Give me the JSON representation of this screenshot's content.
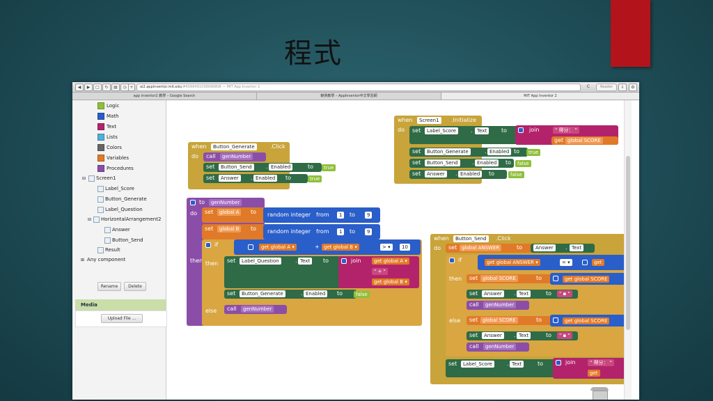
{
  "slide": {
    "title": "程式"
  },
  "browser": {
    "url": "ai2.appinventor.mit.edu",
    "url_rest": "/#6566491038996808 — MIT App Inventor 2",
    "reader": "Reader",
    "tabs": [
      "app inventor2 教學 – Google Search",
      "範例教學 – AppInventor中文學習網",
      "MIT App Inventor 2"
    ]
  },
  "sidebar": {
    "builtin": [
      "Logic",
      "Math",
      "Text",
      "Lists",
      "Colors",
      "Variables",
      "Procedures"
    ],
    "builtin_colors": [
      "#8fbf3a",
      "#2a5ec9",
      "#b3236b",
      "#52aedb",
      "#666666",
      "#e07a28",
      "#8b4ea8"
    ],
    "screen": "Screen1",
    "components": [
      "Label_Score",
      "Button_Generate",
      "Label_Question",
      "HorizontalArrangement2",
      "Answer",
      "Button_Send",
      "Result"
    ],
    "any_component": "Any component",
    "rename": "Rename",
    "delete": "Delete",
    "media": "Media",
    "upload": "Upload File ..."
  },
  "blocks": {
    "init": {
      "when": "when",
      "comp": "Screen1",
      "event": ".Initialize",
      "do": "do",
      "r1": [
        "set",
        "Label_Score",
        ".",
        "Text",
        "to"
      ],
      "join": "join",
      "str": "\" 得分： \"",
      "get_score": "get",
      "score_var": "global SCORE",
      "r2": [
        "set",
        "Button_Generate",
        ".",
        "Enabled",
        "to",
        "true"
      ],
      "r3": [
        "set",
        "Button_Send",
        ".",
        "Enabled",
        "to",
        "false"
      ],
      "r4": [
        "set",
        "Answer",
        ".",
        "Enabled",
        "to",
        "false"
      ]
    },
    "gen_click": {
      "when": "when",
      "comp": "Button_Generate",
      "event": ".Click",
      "do": "do",
      "call": "call",
      "proc": "genNumber",
      "r2": [
        "set",
        "Button_Send",
        ".",
        "Enabled",
        "to",
        "true"
      ],
      "r3": [
        "set",
        "Answer",
        ".",
        "Enabled",
        "to",
        "true"
      ]
    },
    "proc": {
      "to": "to",
      "name": "genNumber",
      "do": "do",
      "setA": [
        "set",
        "global A",
        "to"
      ],
      "setB": [
        "set",
        "global B",
        "to"
      ],
      "rand": "random integer",
      "from": "from",
      "to2": "to",
      "one": "1",
      "nine": "9",
      "if": "if",
      "getA": "get",
      "gA": "global A",
      "plus": "+",
      "getB": "get",
      "gB": "global B",
      "op": ">",
      "ten": "10",
      "then": "then",
      "setQ": [
        "set",
        "Label_Question",
        ".",
        "Text",
        "to"
      ],
      "join": "join",
      "plus_str": "\" + \"",
      "setGen": [
        "set",
        "Button_Generate",
        ".",
        "Enabled",
        "to",
        "false"
      ],
      "else": "else",
      "call": "call"
    },
    "send": {
      "when": "when",
      "comp": "Button_Send",
      "event": ".Click",
      "do": "do",
      "setAns": [
        "set",
        "global ANSWER",
        "to"
      ],
      "ans_src": [
        "Answer",
        ".",
        "Text"
      ],
      "if": "if",
      "getAns": "get",
      "gAns": "global ANSWER",
      "eq": "=",
      "get_trunc": "get",
      "then": "then",
      "else": "else",
      "setScore": [
        "set",
        "global SCORE",
        "to"
      ],
      "gScore": "global SCORE",
      "clearAns": [
        "set",
        "Answer",
        ".",
        "Text",
        "to"
      ],
      "call": "call",
      "proc": "genNumber",
      "setLbl": [
        "set",
        "Label_Score",
        ".",
        "Text",
        "to"
      ],
      "join": "join",
      "str": "\" 得分： \"",
      "get_trunc2": "get"
    }
  },
  "colors": {
    "event": "#c8a43a",
    "proc": "#8b4ea8",
    "setter": "#2f6b46",
    "var": "#e07a28",
    "math": "#2a5ec9",
    "text": "#b3236b",
    "logic": "#8fbf3a",
    "control": "#d9a641"
  }
}
